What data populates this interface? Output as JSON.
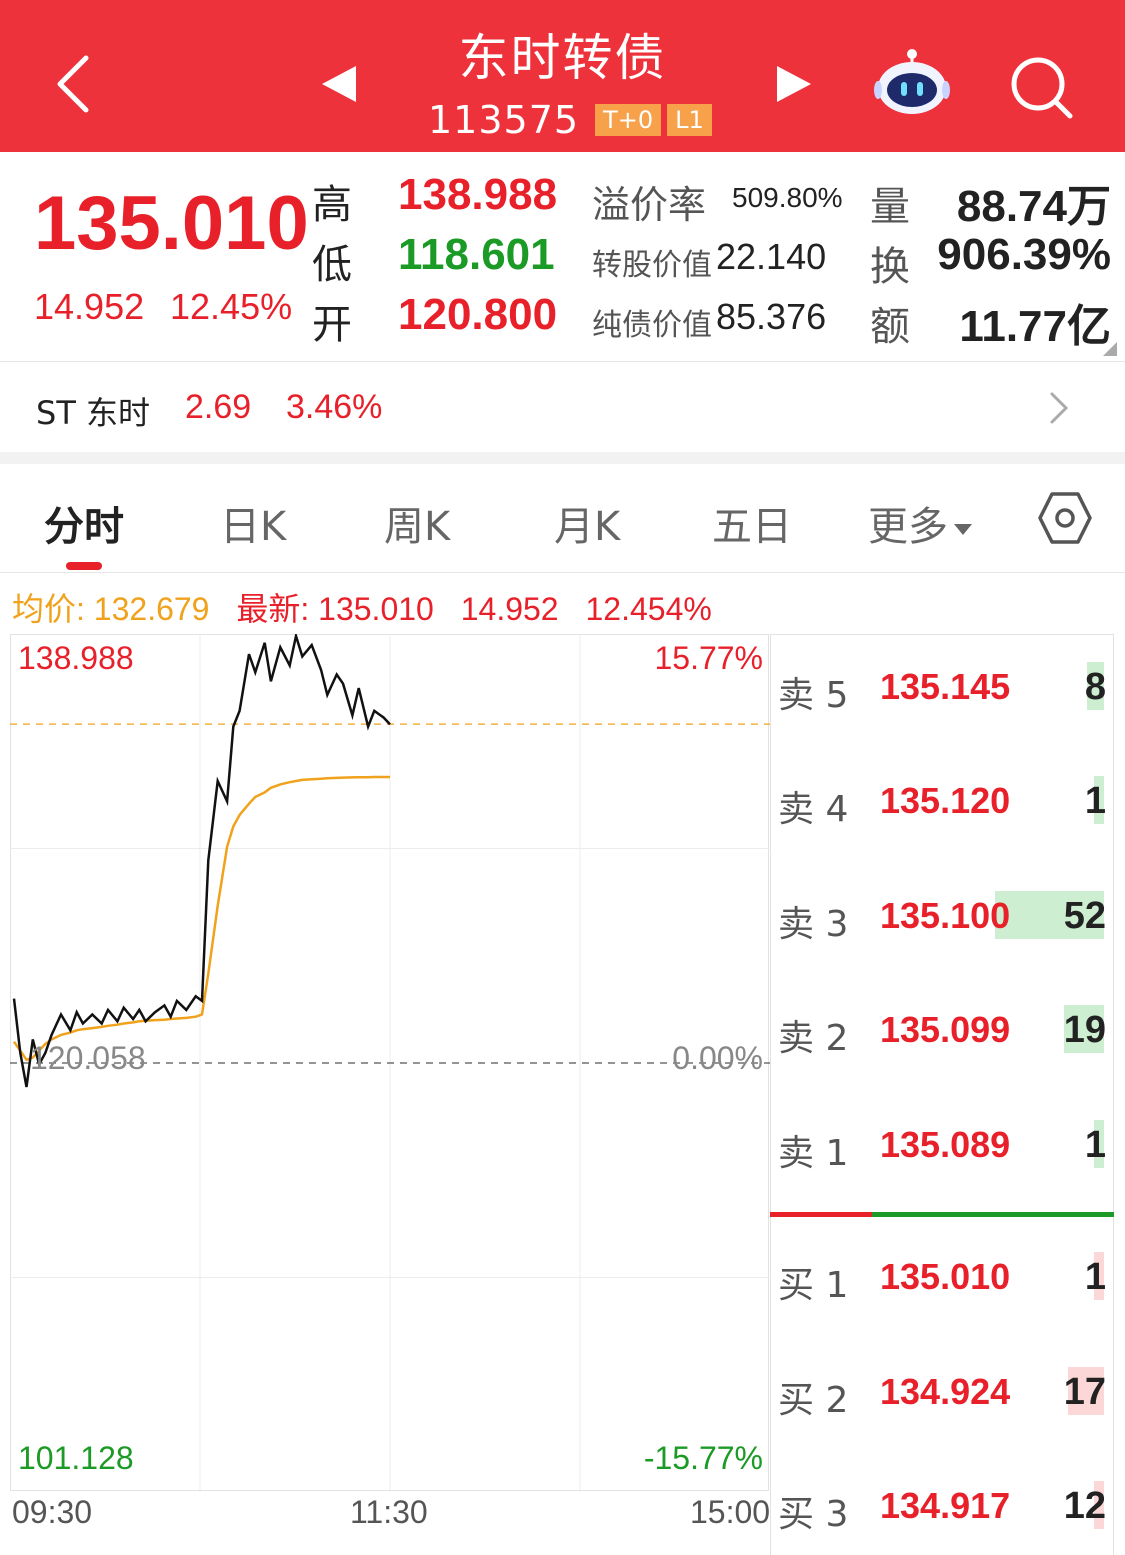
{
  "header": {
    "title": "东时转债",
    "code": "113575",
    "tags": [
      "T+0",
      "L1"
    ]
  },
  "quote": {
    "price": "135.010",
    "change": "14.952",
    "change_pct": "12.45%",
    "high_label": "高",
    "high": "138.988",
    "low_label": "低",
    "low": "118.601",
    "open_label": "开",
    "open": "120.800",
    "premium_label": "溢价率",
    "premium": "509.80%",
    "conv_value_label": "转股价值",
    "conv_value": "22.140",
    "bond_value_label": "纯债价值",
    "bond_value": "85.376",
    "volume_label": "量",
    "volume": "88.74万",
    "turnover_label": "换",
    "turnover": "906.39%",
    "amount_label": "额",
    "amount": "11.77亿"
  },
  "stock": {
    "name": "ST 东时",
    "price": "2.69",
    "pct": "3.46%"
  },
  "tabs": [
    "分时",
    "日K",
    "周K",
    "月K",
    "五日",
    "更多"
  ],
  "info": {
    "avg_label": "均价:",
    "avg": "132.679",
    "latest_label": "最新:",
    "latest": "135.010",
    "latest_change": "14.952",
    "latest_pct": "12.454%"
  },
  "chart_data": {
    "type": "line",
    "y_max_label": "138.988",
    "y_min_label": "101.128",
    "pct_max_label": "15.77%",
    "pct_min_label": "-15.77%",
    "prev_close_label": "120.058",
    "zero_pct_label": "0.00%",
    "time_labels": [
      "09:30",
      "11:30",
      "15:00"
    ],
    "ylim": [
      101.128,
      138.988
    ],
    "prev_close": 120.058,
    "current_price": 135.01,
    "x_minutes": [
      0,
      2,
      4,
      6,
      8,
      10,
      12,
      15,
      18,
      20,
      22,
      25,
      28,
      30,
      33,
      35,
      38,
      40,
      42,
      45,
      48,
      50,
      52,
      55,
      58,
      60,
      62,
      65,
      68,
      70,
      72,
      75,
      77,
      80,
      82,
      85,
      88,
      90,
      92,
      95,
      98,
      100,
      103,
      105,
      108,
      110,
      113,
      115,
      118,
      120
    ],
    "price": [
      122.9,
      120.5,
      119.0,
      121.1,
      120.0,
      120.5,
      121.3,
      122.2,
      121.5,
      122.3,
      121.8,
      122.2,
      121.8,
      122.4,
      121.9,
      122.5,
      122.0,
      122.4,
      121.9,
      122.3,
      122.6,
      122.1,
      122.8,
      122.4,
      123.0,
      122.8,
      129.0,
      132.5,
      131.6,
      134.9,
      135.6,
      138.1,
      137.3,
      138.6,
      136.9,
      138.4,
      137.6,
      138.9,
      138.0,
      138.5,
      137.4,
      136.3,
      137.2,
      136.8,
      135.4,
      136.6,
      134.9,
      135.6,
      135.3,
      135.0
    ],
    "avg_price": [
      121.0,
      120.6,
      120.2,
      120.3,
      120.6,
      120.9,
      121.1,
      121.3,
      121.4,
      121.5,
      121.55,
      121.6,
      121.65,
      121.7,
      121.75,
      121.8,
      121.85,
      121.9,
      121.92,
      121.95,
      121.97,
      122.0,
      122.02,
      122.05,
      122.1,
      122.2,
      124.0,
      127.0,
      129.6,
      130.5,
      131.0,
      131.5,
      131.8,
      132.0,
      132.2,
      132.35,
      132.45,
      132.5,
      132.55,
      132.58,
      132.6,
      132.62,
      132.64,
      132.65,
      132.66,
      132.67,
      132.67,
      132.68,
      132.68,
      132.68
    ]
  },
  "order_book": {
    "asks": [
      {
        "label": "卖 5",
        "price": "135.145",
        "qty": "8",
        "bar": 0.08
      },
      {
        "label": "卖 4",
        "price": "135.120",
        "qty": "1",
        "bar": 0.02
      },
      {
        "label": "卖 3",
        "price": "135.100",
        "qty": "52",
        "bar": 0.52
      },
      {
        "label": "卖 2",
        "price": "135.099",
        "qty": "19",
        "bar": 0.19
      },
      {
        "label": "卖 1",
        "price": "135.089",
        "qty": "1",
        "bar": 0.02
      }
    ],
    "bids": [
      {
        "label": "买 1",
        "price": "135.010",
        "qty": "1",
        "bar": 0.02
      },
      {
        "label": "买 2",
        "price": "134.924",
        "qty": "17",
        "bar": 0.17
      },
      {
        "label": "买 3",
        "price": "134.917",
        "qty": "12",
        "bar": 0.04
      }
    ]
  },
  "colors": {
    "header": "#ee323c",
    "up": "#e8202a",
    "down": "#1b9a25",
    "avg_line": "#f0a21c",
    "ask_bar": "#cdeed0",
    "bid_bar": "#fbd7d7"
  }
}
